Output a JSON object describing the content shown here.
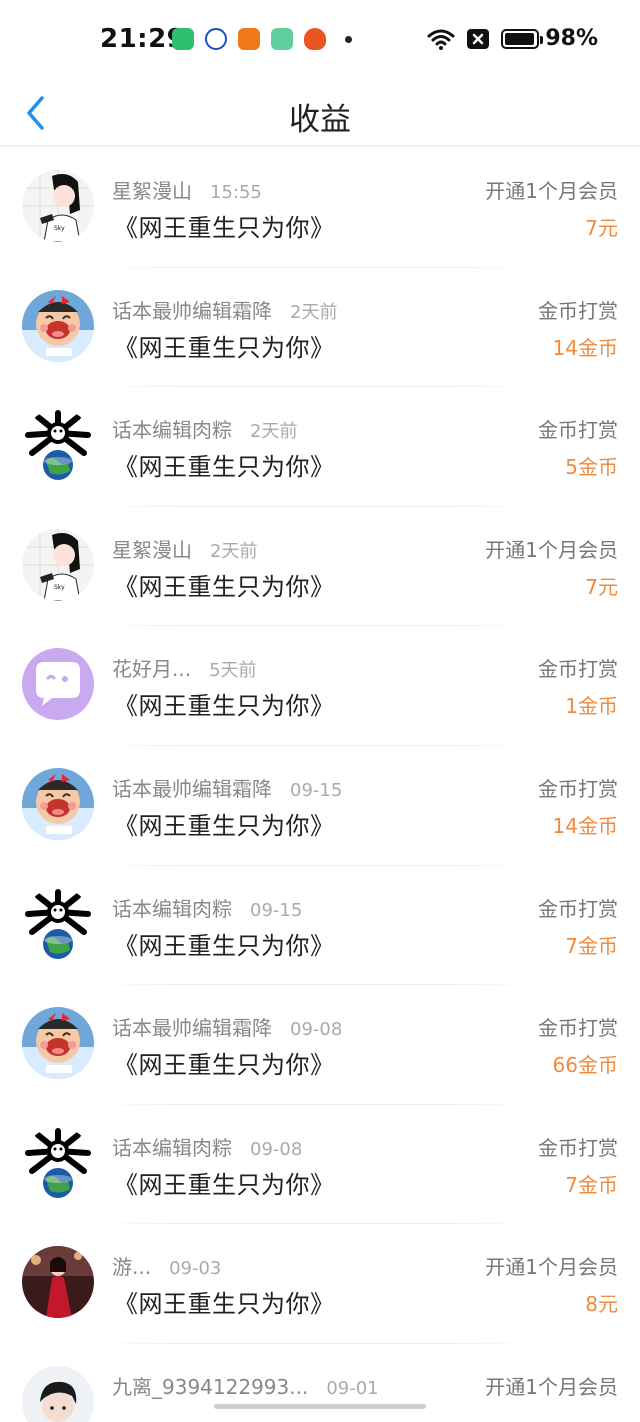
{
  "status_bar": {
    "time": "21:29",
    "battery": "98%"
  },
  "header": {
    "title": "收益"
  },
  "rows": [
    {
      "name": "星絮漫山",
      "time": "15:55",
      "book": "《网王重生只为你》",
      "type": "开通1个月会员",
      "amount": "7元",
      "avatar": "girl"
    },
    {
      "name": "话本最帅编辑霜降",
      "time": "2天前",
      "book": "《网王重生只为你》",
      "type": "金币打赏",
      "amount": "14金币",
      "avatar": "cartoon"
    },
    {
      "name": "话本编辑肉粽",
      "time": "2天前",
      "book": "《网王重生只为你》",
      "type": "金币打赏",
      "amount": "5金币",
      "avatar": "globe"
    },
    {
      "name": "星絮漫山",
      "time": "2天前",
      "book": "《网王重生只为你》",
      "type": "开通1个月会员",
      "amount": "7元",
      "avatar": "girl"
    },
    {
      "name": "花好月...",
      "time": "5天前",
      "book": "《网王重生只为你》",
      "type": "金币打赏",
      "amount": "1金币",
      "avatar": "chat"
    },
    {
      "name": "话本最帅编辑霜降",
      "time": "09-15",
      "book": "《网王重生只为你》",
      "type": "金币打赏",
      "amount": "14金币",
      "avatar": "cartoon"
    },
    {
      "name": "话本编辑肉粽",
      "time": "09-15",
      "book": "《网王重生只为你》",
      "type": "金币打赏",
      "amount": "7金币",
      "avatar": "globe"
    },
    {
      "name": "话本最帅编辑霜降",
      "time": "09-08",
      "book": "《网王重生只为你》",
      "type": "金币打赏",
      "amount": "66金币",
      "avatar": "cartoon"
    },
    {
      "name": "话本编辑肉粽",
      "time": "09-08",
      "book": "《网王重生只为你》",
      "type": "金币打赏",
      "amount": "7金币",
      "avatar": "globe"
    },
    {
      "name": "游...",
      "time": "09-03",
      "book": "《网王重生只为你》",
      "type": "开通1个月会员",
      "amount": "8元",
      "avatar": "red"
    },
    {
      "name": "九离_9394122993...",
      "time": "09-01",
      "book": "",
      "type": "开通1个月会员",
      "amount": "",
      "avatar": "boy"
    }
  ],
  "colors": {
    "accent_blue": "#1f8ff0",
    "amount_orange": "#f08a3c"
  }
}
